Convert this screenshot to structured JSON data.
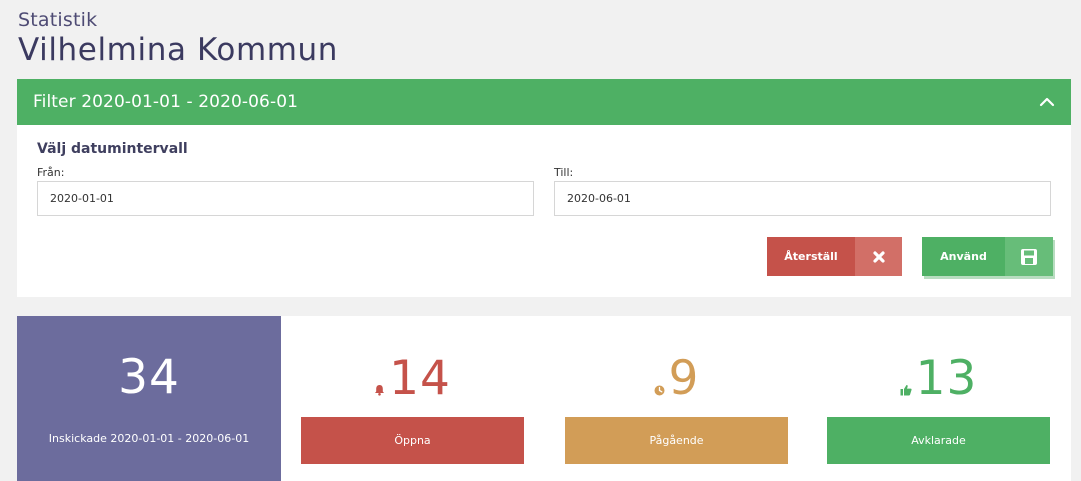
{
  "header": {
    "kicker": "Statistik",
    "title": "Vilhelmina Kommun"
  },
  "filter": {
    "title": "Filter 2020-01-01 - 2020-06-01",
    "range_heading": "Välj datumintervall",
    "from_label": "Från:",
    "from_value": "2020-01-01",
    "to_label": "Till:",
    "to_value": "2020-06-01",
    "reset_label": "Återställ",
    "apply_label": "Använd",
    "reset_icon": "close-x-icon",
    "apply_icon": "save-floppy-icon",
    "toggle_icon": "chevron-up-icon"
  },
  "stats": {
    "total": {
      "value": "34",
      "caption": "Inskickade 2020-01-01 - 2020-06-01"
    },
    "open": {
      "value": "14",
      "label": "Öppna",
      "icon": "bell-icon",
      "color": "#c5524a"
    },
    "in_progress": {
      "value": "9",
      "label": "Pågående",
      "icon": "clock-icon",
      "color": "#d29d57"
    },
    "resolved": {
      "value": "13",
      "label": "Avklarade",
      "icon": "thumbs-up-icon",
      "color": "#4eb064"
    }
  },
  "colors": {
    "green": "#4eb064",
    "red": "#c5524a",
    "orange": "#d29d57",
    "purple": "#6c6c9d"
  }
}
